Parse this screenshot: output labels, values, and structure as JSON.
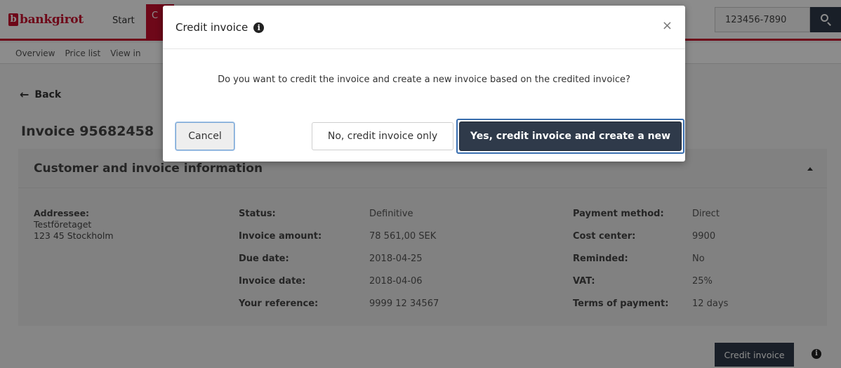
{
  "app": {
    "logo_mark": "b",
    "logo_text": "bankgirot",
    "nav": {
      "start": "Start",
      "active": "C"
    },
    "search": {
      "value": "123456-7890"
    }
  },
  "subnav": [
    "Overview",
    "Price list",
    "View in"
  ],
  "page": {
    "back_label": "Back",
    "title": "Invoice 95682458",
    "card_title": "Customer and invoice information",
    "addressee": {
      "label": "Addressee:",
      "line1": "Testföretaget",
      "line2": "123 45 Stockholm"
    },
    "left_fields": [
      {
        "label": "Status:",
        "value": "Definitive"
      },
      {
        "label": "Invoice amount:",
        "value": "78 561,00 SEK"
      },
      {
        "label": "Due date:",
        "value": "2018-04-25"
      },
      {
        "label": "Invoice date:",
        "value": "2018-04-06"
      },
      {
        "label": "Your reference:",
        "value": "9999 12 34567"
      }
    ],
    "right_fields": [
      {
        "label": "Payment method:",
        "value": "Direct"
      },
      {
        "label": "Cost center:",
        "value": "9900"
      },
      {
        "label": "Reminded:",
        "value": "No"
      },
      {
        "label": "VAT:",
        "value": "25%"
      },
      {
        "label": "Terms of payment:",
        "value": "12 days"
      }
    ],
    "credit_button": "Credit invoice",
    "info_glyph": "i"
  },
  "modal": {
    "title": "Credit invoice",
    "info_glyph": "i",
    "close_glyph": "×",
    "message": "Do you want to credit the invoice and create a new invoice based on the credited invoice?",
    "cancel": "Cancel",
    "no": "No, credit invoice only",
    "yes": "Yes, credit invoice and create a new"
  },
  "colors": {
    "brand": "#c8102e",
    "primary": "#2f3a4a",
    "focus": "#3a6fb0"
  }
}
